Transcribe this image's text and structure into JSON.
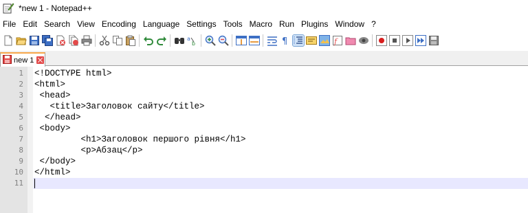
{
  "window": {
    "title": "*new 1 - Notepad++",
    "app_icon": "notepad-plus-plus-icon"
  },
  "menu": [
    "File",
    "Edit",
    "Search",
    "View",
    "Encoding",
    "Language",
    "Settings",
    "Tools",
    "Macro",
    "Run",
    "Plugins",
    "Window",
    "?"
  ],
  "toolbar": {
    "icons": [
      "new-file-icon",
      "open-file-icon",
      "save-icon",
      "save-all-icon",
      "close-icon",
      "close-all-icon",
      "print-icon",
      "cut-icon",
      "copy-icon",
      "paste-icon",
      "undo-icon",
      "redo-icon",
      "find-icon",
      "replace-icon",
      "zoom-in-icon",
      "zoom-out-icon",
      "sync-vertical-icon",
      "sync-horizontal-icon",
      "word-wrap-icon",
      "show-all-characters-icon",
      "indent-guide-icon",
      "language-udl-icon",
      "document-map-icon",
      "function-list-icon",
      "folder-as-workspace-icon",
      "monitoring-icon",
      "record-macro-icon",
      "stop-recording-icon",
      "playback-macro-icon",
      "run-macro-multiple-icon",
      "save-macro-icon"
    ],
    "active_icon": "indent-guide-icon"
  },
  "tabs": [
    {
      "label": "new 1",
      "icon": "unsaved-file-icon",
      "close_icon": "close-tab-icon"
    }
  ],
  "editor": {
    "line_numbers": [
      "1",
      "2",
      "3",
      "4",
      "5",
      "6",
      "7",
      "8",
      "9",
      "10",
      "11"
    ],
    "lines": [
      "<!DOCTYPE html>",
      "<html>",
      " <head>",
      "   <title>Заголовок сайту</title>",
      "  </head>",
      " <body>",
      "         <h1>Заголовок першого рівня</h1>",
      "         <p>Абзац</p>",
      " </body>",
      "</html>",
      ""
    ],
    "current_line": 11,
    "current_line_color": "#e8e8ff"
  },
  "colors": {
    "tab_accent": "#f7a64a",
    "gutter_bg": "#e4e4e4"
  }
}
